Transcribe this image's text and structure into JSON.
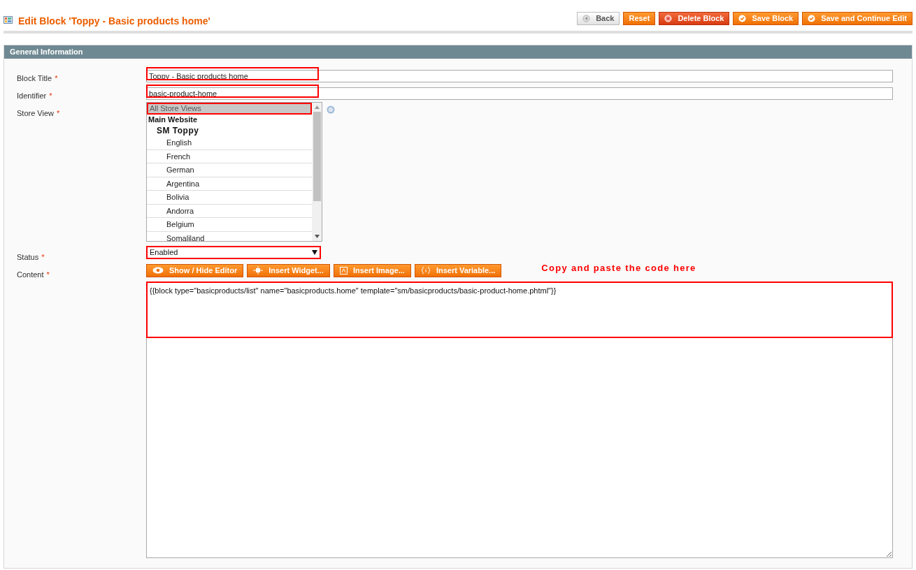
{
  "header": {
    "title": "Edit Block 'Toppy - Basic products home'",
    "buttons": [
      {
        "label": "Back",
        "kind": "back"
      },
      {
        "label": "Reset",
        "kind": "plain"
      },
      {
        "label": "Delete Block",
        "kind": "delete"
      },
      {
        "label": "Save Block",
        "kind": "save"
      },
      {
        "label": "Save and Continue Edit",
        "kind": "save"
      }
    ]
  },
  "section": {
    "title": "General Information"
  },
  "fields": [
    {
      "label": "Block Title",
      "required_mark": "*",
      "kind": "text",
      "value": "Toppy - Basic products home",
      "highlighted": true
    },
    {
      "label": "Identifier",
      "required_mark": "*",
      "kind": "text",
      "value": "basic-product-home",
      "highlighted": true
    },
    {
      "label": "Store View",
      "required_mark": "*",
      "kind": "multiselect",
      "highlighted": true,
      "options": [
        {
          "label": "All Store Views",
          "kind": "option",
          "selected": true
        },
        {
          "label": "Main Website",
          "kind": "website",
          "selected": false
        },
        {
          "label": "SM Toppy",
          "kind": "store",
          "selected": false
        },
        {
          "label": "English",
          "kind": "option",
          "selected": false
        },
        {
          "label": "French",
          "kind": "option",
          "selected": false
        },
        {
          "label": "German",
          "kind": "option",
          "selected": false
        },
        {
          "label": "Argentina",
          "kind": "option",
          "selected": false
        },
        {
          "label": "Bolivia",
          "kind": "option",
          "selected": false
        },
        {
          "label": "Andorra",
          "kind": "option",
          "selected": false
        },
        {
          "label": "Belgium",
          "kind": "option",
          "selected": false
        },
        {
          "label": "Somaliland",
          "kind": "option",
          "selected": false
        }
      ]
    },
    {
      "label": "Status",
      "required_mark": "*",
      "kind": "select",
      "value": "Enabled",
      "highlighted": true
    },
    {
      "label": "Content",
      "required_mark": "*",
      "kind": "editor",
      "highlighted": true,
      "tools": [
        {
          "label": "Show / Hide Editor",
          "kind": "eye"
        },
        {
          "label": "Insert Widget...",
          "kind": "widget"
        },
        {
          "label": "Insert Image...",
          "kind": "image"
        },
        {
          "label": "Insert Variable...",
          "kind": "variable"
        }
      ],
      "annotation": "Copy and paste the code here",
      "value": "{{block type=\"basicproducts/list\" name=\"basicproducts.home\" template=\"sm/basicproducts/basic-product-home.phtml\"}}"
    }
  ]
}
